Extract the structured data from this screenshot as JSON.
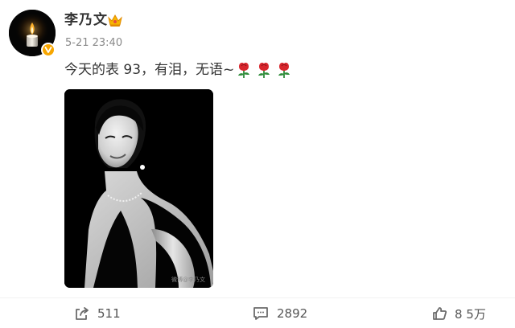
{
  "post": {
    "author": {
      "name": "李乃文",
      "avatar_icon": "candle-icon",
      "verified_icon": "verified-badge-icon",
      "member_icon": "crown-icon"
    },
    "timestamp": "5-21 23:40",
    "text": "今天的表 93，有泪，无语~",
    "emoji": [
      "rose-emoji",
      "rose-emoji",
      "rose-emoji"
    ],
    "image": {
      "description_icon": "portrait-photo",
      "watermark": "微博@李乃文"
    },
    "actions": {
      "repost_count": "511",
      "comment_count": "2892",
      "like_count": "8 5万"
    }
  },
  "colors": {
    "text": "#333333",
    "muted": "#8a8a8a",
    "badge": "#f7a600",
    "rose": "#d8262d",
    "leaf": "#2f8c3a"
  }
}
